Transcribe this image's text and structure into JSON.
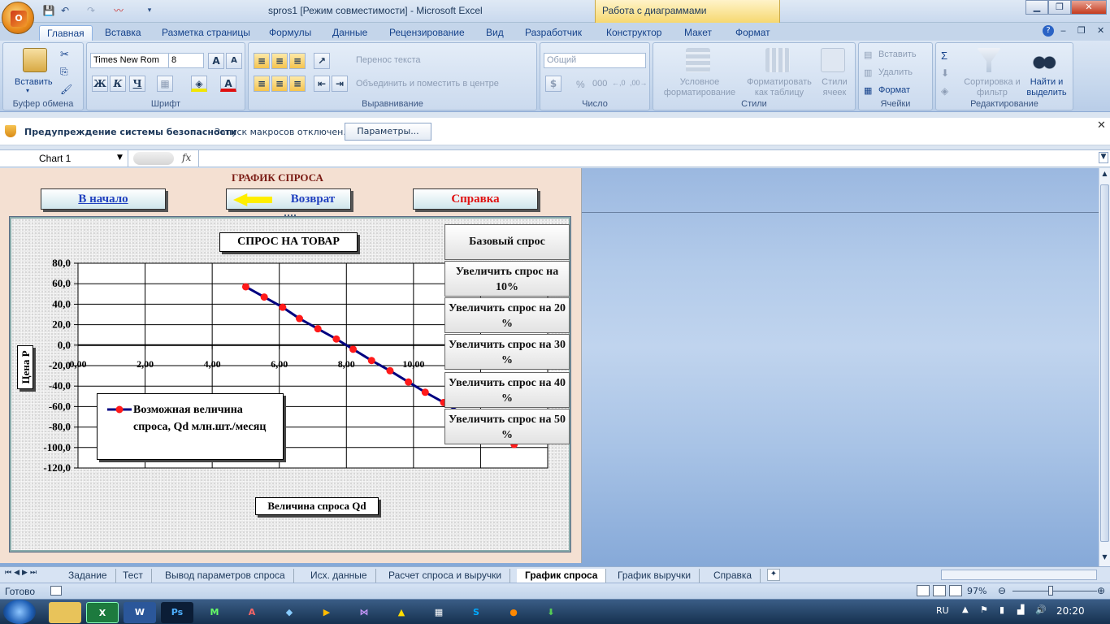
{
  "window": {
    "title": "spros1  [Режим совместимости] - Microsoft Excel",
    "contextual_tab_group": "Работа с диаграммами",
    "office_logo": "О"
  },
  "ribbon_tabs": [
    "Главная",
    "Вставка",
    "Разметка страницы",
    "Формулы",
    "Данные",
    "Рецензирование",
    "Вид",
    "Разработчик",
    "Конструктор",
    "Макет",
    "Формат"
  ],
  "ribbon": {
    "clipboard": {
      "label": "Буфер обмена",
      "paste": "Вставить"
    },
    "font": {
      "label": "Шрифт",
      "name": "Times New Rom",
      "size": "8",
      "bold": "Ж",
      "italic": "К",
      "underline": "Ч"
    },
    "alignment": {
      "label": "Выравнивание",
      "wrap": "Перенос текста",
      "merge": "Объединить и поместить в центре"
    },
    "number": {
      "label": "Число",
      "format": "Общий",
      "percent": "%",
      "thousands": "000"
    },
    "styles": {
      "label": "Стили",
      "conditional": "Условное форматирование",
      "as_table": "Форматировать как таблицу",
      "cell_styles": "Стили ячеек"
    },
    "cells": {
      "label": "Ячейки",
      "insert": "Вставить",
      "delete": "Удалить",
      "format": "Формат"
    },
    "editing": {
      "label": "Редактирование",
      "sort": "Сортировка и фильтр",
      "find": "Найти и выделить"
    }
  },
  "security": {
    "title": "Предупреждение системы безопасности",
    "message": "Запуск макросов отключен.",
    "button": "Параметры..."
  },
  "formula_bar": {
    "name_box": "Chart 1",
    "fx": "fx",
    "value": ""
  },
  "sheet": {
    "title": "ГРАФИК СПРОСА",
    "btn_home": "В начало",
    "btn_back": "Возврат",
    "btn_help": "Справка",
    "colors": {
      "home": "#1f3fbf",
      "back": "#1f3fbf",
      "help": "#e01010",
      "arrow": "#ffee00"
    }
  },
  "chart_data": {
    "type": "line",
    "title": "СПРОС НА ТОВАР",
    "xlabel": "Величина спроса Qd",
    "ylabel": "Цена P",
    "xlim": [
      0,
      14
    ],
    "ylim": [
      -120,
      80
    ],
    "x_ticks": [
      "0,00",
      "2,00",
      "4,00",
      "6,00",
      "8,00",
      "10,00"
    ],
    "y_ticks": [
      "80,0",
      "60,0",
      "40,0",
      "20,0",
      "0,0",
      "-20,0",
      "-40,0",
      "-60,0",
      "-80,0",
      "-100,0",
      "-120,0"
    ],
    "series": [
      {
        "name": "Возможная величина спроса, Qd млн.шт./месяц",
        "color": "#000080",
        "marker_color": "#ff1a1a",
        "x": [
          5.0,
          5.55,
          6.1,
          6.6,
          7.15,
          7.7,
          8.2,
          8.75,
          9.3,
          9.85,
          10.35,
          10.9,
          13.0
        ],
        "y": [
          57,
          47,
          37,
          26,
          16,
          6,
          -4,
          -15,
          -25,
          -36,
          -46,
          -56,
          -97
        ]
      }
    ],
    "legend_position": "bottom-left",
    "grid": true
  },
  "side_buttons": [
    "Базовый спрос",
    "Увеличить спрос на 10%",
    "Увеличить спрос на 20 %",
    "Увеличить спрос на 30 %",
    "Увеличить спрос на 40 %",
    "Увеличить спрос на 50 %"
  ],
  "sheet_tabs": [
    "Задание",
    "Тест",
    "Вывод параметров спроса",
    "Исх. данные",
    "Расчет спроса и выручки",
    "График спроса",
    "График выручки",
    "Справка"
  ],
  "active_sheet_tab": "График спроса",
  "status": {
    "ready": "Готово",
    "zoom": "97%"
  },
  "taskbar": {
    "lang": "RU",
    "time": "20:20"
  }
}
